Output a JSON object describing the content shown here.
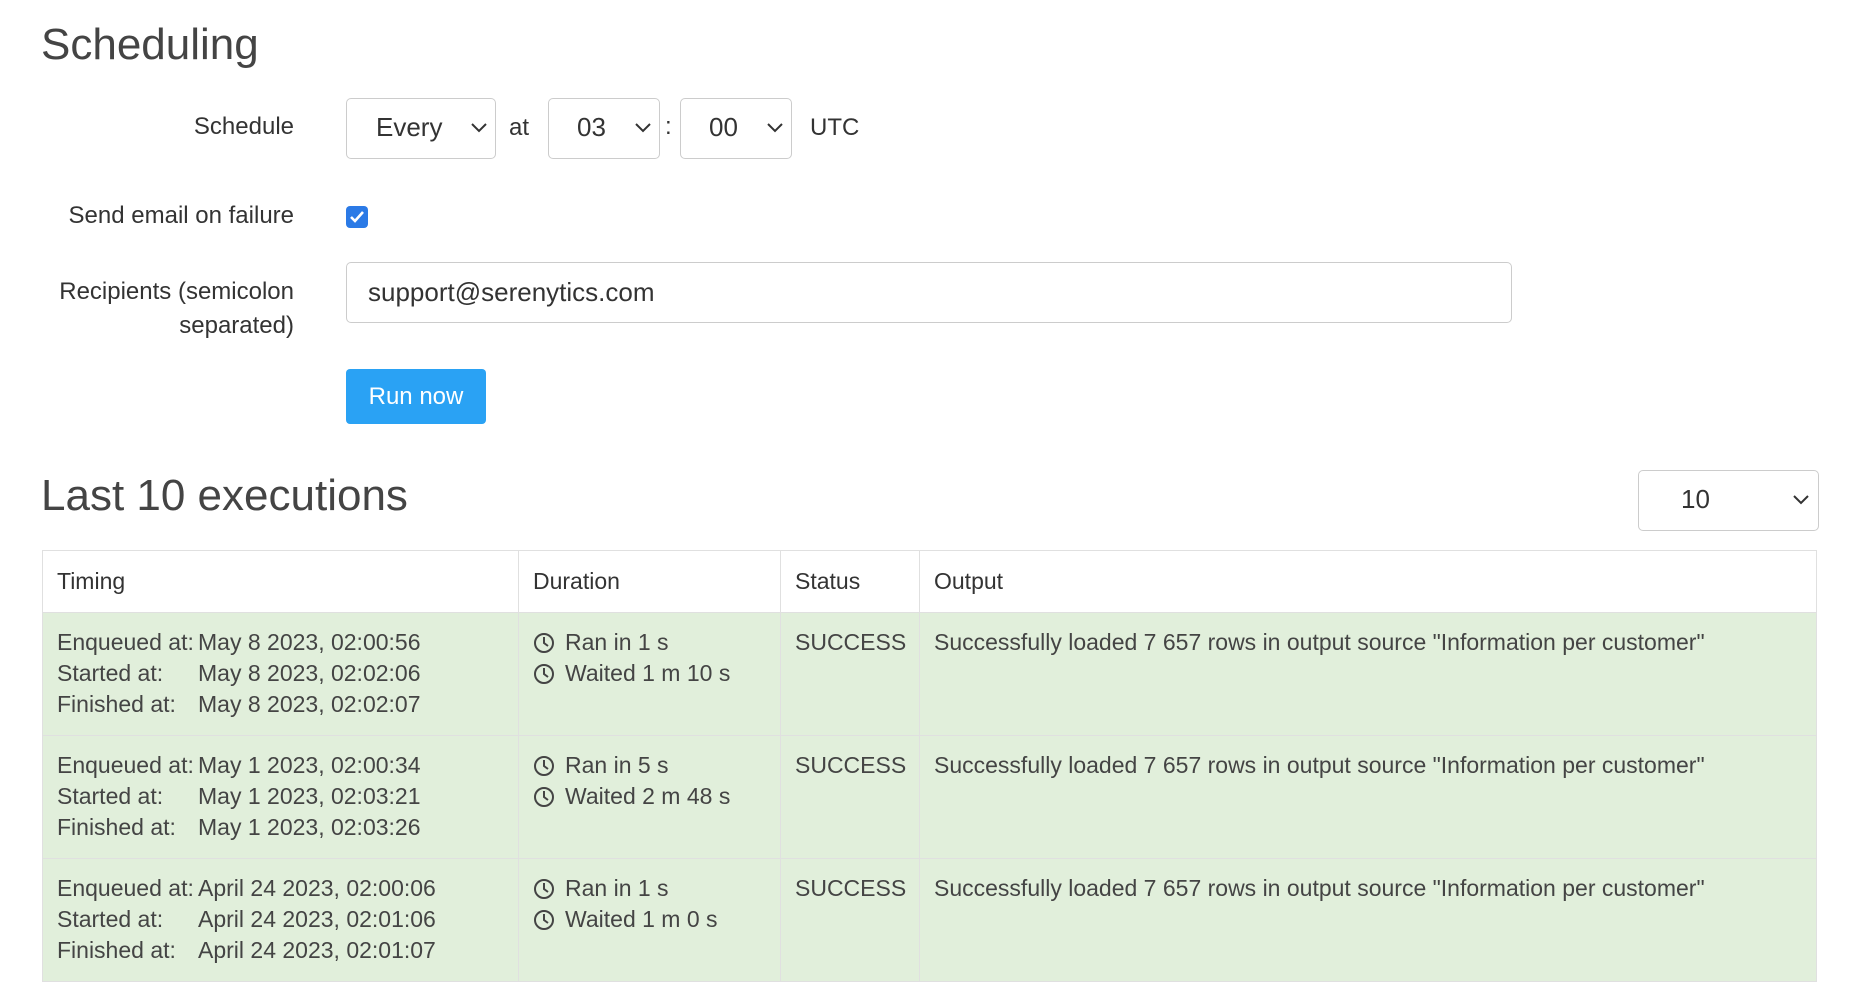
{
  "scheduling": {
    "title": "Scheduling",
    "schedule_label": "Schedule",
    "frequency": "Every",
    "at_label": "at",
    "hour": "03",
    "colon": ":",
    "minute": "00",
    "timezone": "UTC",
    "email_label": "Send email on failure",
    "email_checked": true,
    "recipients_label_line1": "Recipients (semicolon",
    "recipients_label_line2": "separated)",
    "recipients_value": "support@serenytics.com",
    "run_button": "Run now"
  },
  "executions": {
    "title": "Last 10 executions",
    "count_select": "10",
    "columns": [
      "Timing",
      "Duration",
      "Status",
      "Output"
    ],
    "timing_keys": [
      "Enqueued at:",
      "Started at:",
      "Finished at:"
    ],
    "rows": [
      {
        "enqueued": "May 8 2023, 02:00:56",
        "started": "May 8 2023, 02:02:06",
        "finished": "May 8 2023, 02:02:07",
        "ran": "Ran in 1 s",
        "waited": "Waited 1 m 10 s",
        "status": "SUCCESS",
        "output": "Successfully loaded 7 657 rows in output source \"Information per customer\""
      },
      {
        "enqueued": "May 1 2023, 02:00:34",
        "started": "May 1 2023, 02:03:21",
        "finished": "May 1 2023, 02:03:26",
        "ran": "Ran in 5 s",
        "waited": "Waited 2 m 48 s",
        "status": "SUCCESS",
        "output": "Successfully loaded 7 657 rows in output source \"Information per customer\""
      },
      {
        "enqueued": "April 24 2023, 02:00:06",
        "started": "April 24 2023, 02:01:06",
        "finished": "April 24 2023, 02:01:07",
        "ran": "Ran in 1 s",
        "waited": "Waited 1 m 0 s",
        "status": "SUCCESS",
        "output": "Successfully loaded 7 657 rows in output source \"Information per customer\""
      }
    ]
  },
  "colors": {
    "success_row": "#e1efdb",
    "primary_button": "#2aa2f4",
    "checkbox": "#2b7ae6"
  },
  "icons": [
    "chevron-down-icon",
    "clock-icon",
    "checkmark-icon"
  ]
}
